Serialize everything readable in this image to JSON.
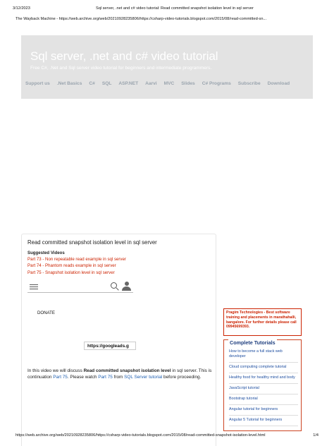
{
  "print": {
    "date": "3/12/2023",
    "title": "Sql server, .net and c# video tutorial: Read committed snapshot isolation level in sql server",
    "wayback": "The Wayback Machine - https://web.archive.org/web/20210928235806/https://csharp-video-tutorials.blogspot.com/2015/08/read-committed-sn...",
    "footer_url": "https://web.archive.org/web/20210928235806/https://csharp-video-tutorials.blogspot.com/2015/08/read-committed-snapshot-isolation-level.html",
    "page": "1/4"
  },
  "site": {
    "title": "Sql server, .net and c# video tutorial",
    "description": "Free C#, .Net and Sql server video tutorial for beginners and intermediate programmers."
  },
  "nav": [
    "Support us",
    ".Net Basics",
    "C#",
    "SQL",
    "ASP.NET",
    "Aarvi",
    "MVC",
    "Slides",
    "C# Programs",
    "Subscribe",
    "Download"
  ],
  "post": {
    "title": "Read committed snapshot isolation level in sql server",
    "suggested_label": "Suggested Videos",
    "suggested": [
      "Part 73 - Non repeatable read example in sql server",
      "Part 74 - Phantom reads example in sql server",
      "Part 75 - Snapshot isolation level in sql server"
    ],
    "donate": "DONATE",
    "ad_url": "https://googleads.g",
    "body_1": "In this video we will discuss ",
    "body_bold": "Read committed snapshot isolation level",
    "body_2": " in sql server. This is continuation ",
    "link_part75": "Part 75",
    "body_3": ". Please watch ",
    "link_part75b": "Part 75",
    "body_4": " from ",
    "link_series": "SQL Server tutorial",
    "body_5": " before proceeding."
  },
  "ad_box": "Pragim Technologies - Best software training and placements in marathahalli, bangalore. For further details please call 09945699393.",
  "tutorials": {
    "heading": "Complete Tutorials",
    "items": [
      "How to become a full stack web developer",
      "Cloud computing complete tutorial",
      "Healthy food for healthy mind and body",
      "JavaScript tutorial",
      "Bootstrap tutorial",
      "Angular tutorial for beginners",
      "Angular 5 Tutorial for beginners"
    ]
  },
  "colors": {
    "banner_bg": "#e3e3e3",
    "link": "#1f5fb0",
    "accent_red": "#cc2200"
  },
  "icons": [
    "hamburger-icon",
    "search-icon",
    "person-icon"
  ]
}
